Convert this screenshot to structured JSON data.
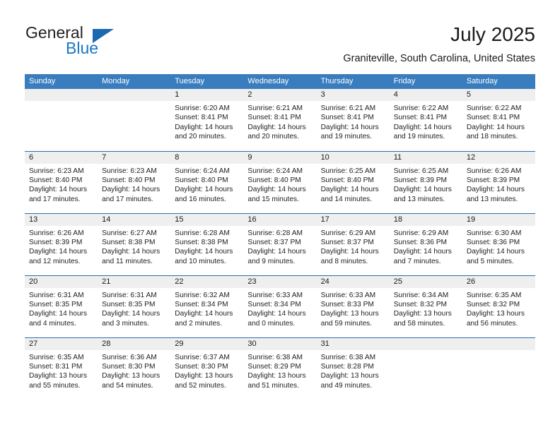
{
  "branding": {
    "logo_text_primary": "General",
    "logo_text_secondary": "Blue",
    "accent_color": "#1b69b0",
    "blue_text_color": "#1877c2"
  },
  "header": {
    "title": "July 2025",
    "subtitle": "Graniteville, South Carolina, United States"
  },
  "theme": {
    "header_band_color": "#3a7dbe",
    "row_divider_color": "#2b6cb0",
    "daynum_band_color": "#efefef",
    "cell_background": "#ffffff",
    "text_color": "#222222"
  },
  "calendar": {
    "month": "July",
    "year": "2025",
    "weekdays": [
      "Sunday",
      "Monday",
      "Tuesday",
      "Wednesday",
      "Thursday",
      "Friday",
      "Saturday"
    ],
    "labels": {
      "sunrise": "Sunrise:",
      "sunset": "Sunset:",
      "daylight": "Daylight:"
    },
    "weeks": [
      [
        {
          "day": "",
          "lines": []
        },
        {
          "day": "",
          "lines": []
        },
        {
          "day": "1",
          "lines": [
            "Sunrise: 6:20 AM",
            "Sunset: 8:41 PM",
            "Daylight: 14 hours",
            "and 20 minutes."
          ]
        },
        {
          "day": "2",
          "lines": [
            "Sunrise: 6:21 AM",
            "Sunset: 8:41 PM",
            "Daylight: 14 hours",
            "and 20 minutes."
          ]
        },
        {
          "day": "3",
          "lines": [
            "Sunrise: 6:21 AM",
            "Sunset: 8:41 PM",
            "Daylight: 14 hours",
            "and 19 minutes."
          ]
        },
        {
          "day": "4",
          "lines": [
            "Sunrise: 6:22 AM",
            "Sunset: 8:41 PM",
            "Daylight: 14 hours",
            "and 19 minutes."
          ]
        },
        {
          "day": "5",
          "lines": [
            "Sunrise: 6:22 AM",
            "Sunset: 8:41 PM",
            "Daylight: 14 hours",
            "and 18 minutes."
          ]
        }
      ],
      [
        {
          "day": "6",
          "lines": [
            "Sunrise: 6:23 AM",
            "Sunset: 8:40 PM",
            "Daylight: 14 hours",
            "and 17 minutes."
          ]
        },
        {
          "day": "7",
          "lines": [
            "Sunrise: 6:23 AM",
            "Sunset: 8:40 PM",
            "Daylight: 14 hours",
            "and 17 minutes."
          ]
        },
        {
          "day": "8",
          "lines": [
            "Sunrise: 6:24 AM",
            "Sunset: 8:40 PM",
            "Daylight: 14 hours",
            "and 16 minutes."
          ]
        },
        {
          "day": "9",
          "lines": [
            "Sunrise: 6:24 AM",
            "Sunset: 8:40 PM",
            "Daylight: 14 hours",
            "and 15 minutes."
          ]
        },
        {
          "day": "10",
          "lines": [
            "Sunrise: 6:25 AM",
            "Sunset: 8:40 PM",
            "Daylight: 14 hours",
            "and 14 minutes."
          ]
        },
        {
          "day": "11",
          "lines": [
            "Sunrise: 6:25 AM",
            "Sunset: 8:39 PM",
            "Daylight: 14 hours",
            "and 13 minutes."
          ]
        },
        {
          "day": "12",
          "lines": [
            "Sunrise: 6:26 AM",
            "Sunset: 8:39 PM",
            "Daylight: 14 hours",
            "and 13 minutes."
          ]
        }
      ],
      [
        {
          "day": "13",
          "lines": [
            "Sunrise: 6:26 AM",
            "Sunset: 8:39 PM",
            "Daylight: 14 hours",
            "and 12 minutes."
          ]
        },
        {
          "day": "14",
          "lines": [
            "Sunrise: 6:27 AM",
            "Sunset: 8:38 PM",
            "Daylight: 14 hours",
            "and 11 minutes."
          ]
        },
        {
          "day": "15",
          "lines": [
            "Sunrise: 6:28 AM",
            "Sunset: 8:38 PM",
            "Daylight: 14 hours",
            "and 10 minutes."
          ]
        },
        {
          "day": "16",
          "lines": [
            "Sunrise: 6:28 AM",
            "Sunset: 8:37 PM",
            "Daylight: 14 hours",
            "and 9 minutes."
          ]
        },
        {
          "day": "17",
          "lines": [
            "Sunrise: 6:29 AM",
            "Sunset: 8:37 PM",
            "Daylight: 14 hours",
            "and 8 minutes."
          ]
        },
        {
          "day": "18",
          "lines": [
            "Sunrise: 6:29 AM",
            "Sunset: 8:36 PM",
            "Daylight: 14 hours",
            "and 7 minutes."
          ]
        },
        {
          "day": "19",
          "lines": [
            "Sunrise: 6:30 AM",
            "Sunset: 8:36 PM",
            "Daylight: 14 hours",
            "and 5 minutes."
          ]
        }
      ],
      [
        {
          "day": "20",
          "lines": [
            "Sunrise: 6:31 AM",
            "Sunset: 8:35 PM",
            "Daylight: 14 hours",
            "and 4 minutes."
          ]
        },
        {
          "day": "21",
          "lines": [
            "Sunrise: 6:31 AM",
            "Sunset: 8:35 PM",
            "Daylight: 14 hours",
            "and 3 minutes."
          ]
        },
        {
          "day": "22",
          "lines": [
            "Sunrise: 6:32 AM",
            "Sunset: 8:34 PM",
            "Daylight: 14 hours",
            "and 2 minutes."
          ]
        },
        {
          "day": "23",
          "lines": [
            "Sunrise: 6:33 AM",
            "Sunset: 8:34 PM",
            "Daylight: 14 hours",
            "and 0 minutes."
          ]
        },
        {
          "day": "24",
          "lines": [
            "Sunrise: 6:33 AM",
            "Sunset: 8:33 PM",
            "Daylight: 13 hours",
            "and 59 minutes."
          ]
        },
        {
          "day": "25",
          "lines": [
            "Sunrise: 6:34 AM",
            "Sunset: 8:32 PM",
            "Daylight: 13 hours",
            "and 58 minutes."
          ]
        },
        {
          "day": "26",
          "lines": [
            "Sunrise: 6:35 AM",
            "Sunset: 8:32 PM",
            "Daylight: 13 hours",
            "and 56 minutes."
          ]
        }
      ],
      [
        {
          "day": "27",
          "lines": [
            "Sunrise: 6:35 AM",
            "Sunset: 8:31 PM",
            "Daylight: 13 hours",
            "and 55 minutes."
          ]
        },
        {
          "day": "28",
          "lines": [
            "Sunrise: 6:36 AM",
            "Sunset: 8:30 PM",
            "Daylight: 13 hours",
            "and 54 minutes."
          ]
        },
        {
          "day": "29",
          "lines": [
            "Sunrise: 6:37 AM",
            "Sunset: 8:30 PM",
            "Daylight: 13 hours",
            "and 52 minutes."
          ]
        },
        {
          "day": "30",
          "lines": [
            "Sunrise: 6:38 AM",
            "Sunset: 8:29 PM",
            "Daylight: 13 hours",
            "and 51 minutes."
          ]
        },
        {
          "day": "31",
          "lines": [
            "Sunrise: 6:38 AM",
            "Sunset: 8:28 PM",
            "Daylight: 13 hours",
            "and 49 minutes."
          ]
        },
        {
          "day": "",
          "lines": []
        },
        {
          "day": "",
          "lines": []
        }
      ]
    ]
  }
}
